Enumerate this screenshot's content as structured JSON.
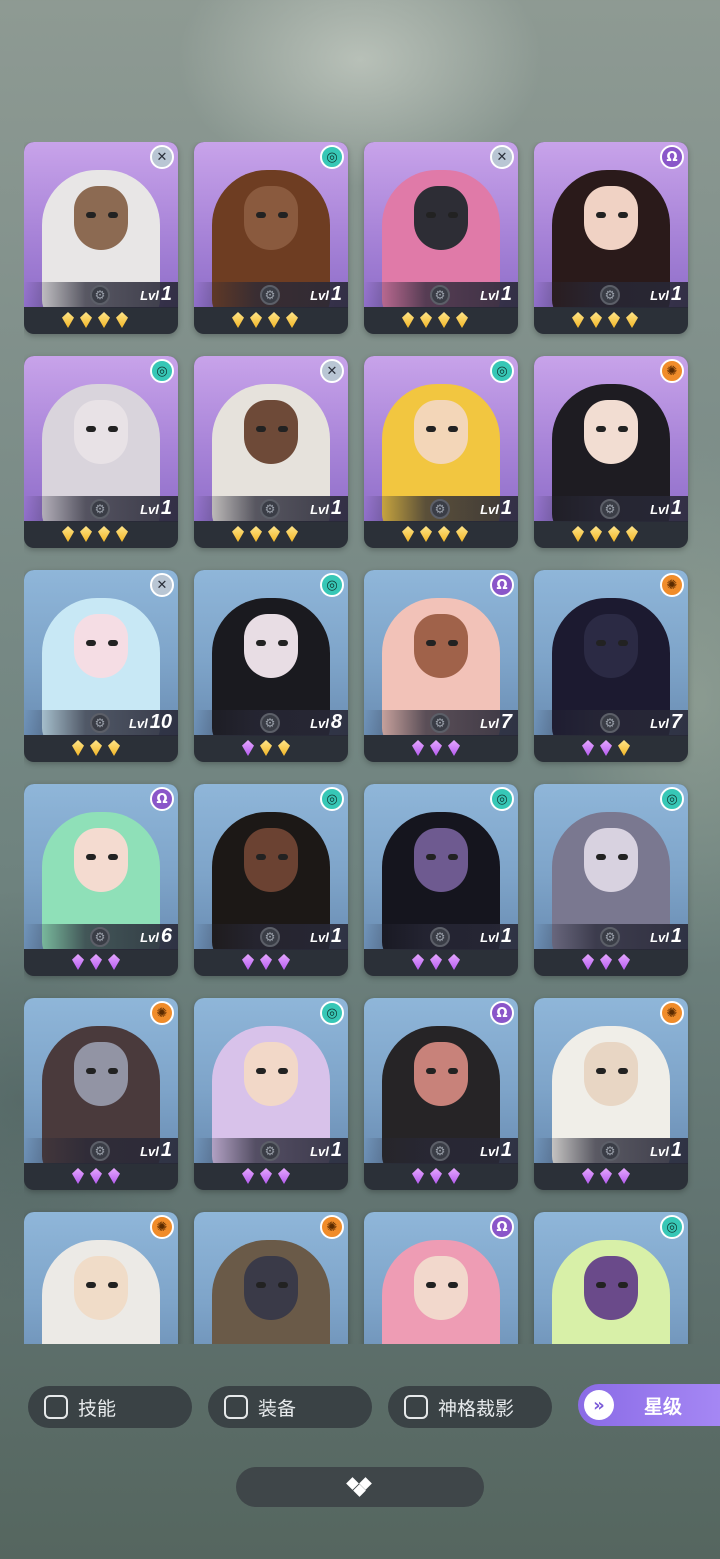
{
  "cards": [
    {
      "bg": "purple",
      "class_icon": "close-x",
      "class_symbol": "✕",
      "level": "1",
      "gems": "gold",
      "gem_count": 4,
      "hair": "#e8e6e6",
      "skin": "#8c6a52"
    },
    {
      "bg": "purple",
      "class_icon": "spiral",
      "class_symbol": "◎",
      "level": "1",
      "gems": "gold",
      "gem_count": 4,
      "hair": "#6e3d22",
      "skin": "#8a5a3e"
    },
    {
      "bg": "purple",
      "class_icon": "close-x",
      "class_symbol": "✕",
      "level": "1",
      "gems": "gold",
      "gem_count": 4,
      "hair": "#e07aa8",
      "skin": "#2d2d35"
    },
    {
      "bg": "purple",
      "class_icon": "omega",
      "class_symbol": "Ω",
      "level": "1",
      "gems": "gold",
      "gem_count": 4,
      "hair": "#2a1a1a",
      "skin": "#f0d2c4"
    },
    {
      "bg": "purple",
      "class_icon": "spiral",
      "class_symbol": "◎",
      "level": "1",
      "gems": "gold",
      "gem_count": 4,
      "hair": "#d9d4dc",
      "skin": "#e8e2e6"
    },
    {
      "bg": "purple",
      "class_icon": "close-x",
      "class_symbol": "✕",
      "level": "1",
      "gems": "gold",
      "gem_count": 4,
      "hair": "#e6e2dc",
      "skin": "#6e4a38"
    },
    {
      "bg": "purple",
      "class_icon": "spiral",
      "class_symbol": "◎",
      "level": "1",
      "gems": "gold",
      "gem_count": 4,
      "hair": "#f2c640",
      "skin": "#f3d6b8"
    },
    {
      "bg": "purple",
      "class_icon": "sun",
      "class_symbol": "✺",
      "level": "1",
      "gems": "gold",
      "gem_count": 4,
      "hair": "#1e1c22",
      "skin": "#f2ddd2"
    },
    {
      "bg": "blue",
      "class_icon": "close-x",
      "class_symbol": "✕",
      "level": "10",
      "gems": "gold",
      "gem_count": 3,
      "hair": "#c8e8f5",
      "skin": "#f5dde4"
    },
    {
      "bg": "blue",
      "class_icon": "spiral",
      "class_symbol": "◎",
      "level": "8",
      "gems": "mixed",
      "gem_count": 3,
      "hair": "#1a1a1f",
      "skin": "#e8dde4"
    },
    {
      "bg": "blue",
      "class_icon": "omega",
      "class_symbol": "Ω",
      "level": "7",
      "gems": "purple",
      "gem_count": 3,
      "hair": "#f2c2b8",
      "skin": "#a0624a"
    },
    {
      "bg": "blue",
      "class_icon": "sun",
      "class_symbol": "✺",
      "level": "7",
      "gems": "mixed2",
      "gem_count": 3,
      "hair": "#1c1a30",
      "skin": "#2b2a44"
    },
    {
      "bg": "blue",
      "class_icon": "omega",
      "class_symbol": "Ω",
      "level": "6",
      "gems": "purple",
      "gem_count": 3,
      "hair": "#8fe0b8",
      "skin": "#f4dbd0"
    },
    {
      "bg": "blue",
      "class_icon": "spiral",
      "class_symbol": "◎",
      "level": "1",
      "gems": "purple",
      "gem_count": 3,
      "hair": "#1c1816",
      "skin": "#6b4232"
    },
    {
      "bg": "blue",
      "class_icon": "spiral",
      "class_symbol": "◎",
      "level": "1",
      "gems": "purple",
      "gem_count": 3,
      "hair": "#15151e",
      "skin": "#6e5a90"
    },
    {
      "bg": "blue",
      "class_icon": "spiral",
      "class_symbol": "◎",
      "level": "1",
      "gems": "purple",
      "gem_count": 3,
      "hair": "#7a7890",
      "skin": "#d8d2e0"
    },
    {
      "bg": "blue",
      "class_icon": "sun",
      "class_symbol": "✺",
      "level": "1",
      "gems": "purple",
      "gem_count": 3,
      "hair": "#4a3a3c",
      "skin": "#9294a4"
    },
    {
      "bg": "blue",
      "class_icon": "spiral",
      "class_symbol": "◎",
      "level": "1",
      "gems": "purple",
      "gem_count": 3,
      "hair": "#d8c2ea",
      "skin": "#f2d8c8"
    },
    {
      "bg": "blue",
      "class_icon": "omega",
      "class_symbol": "Ω",
      "level": "1",
      "gems": "purple",
      "gem_count": 3,
      "hair": "#262426",
      "skin": "#c8827a"
    },
    {
      "bg": "blue",
      "class_icon": "sun",
      "class_symbol": "✺",
      "level": "1",
      "gems": "purple",
      "gem_count": 3,
      "hair": "#f0eee8",
      "skin": "#e8d6c4"
    },
    {
      "bg": "blue",
      "class_icon": "sun",
      "class_symbol": "✺",
      "level": "",
      "gems": "none",
      "gem_count": 0,
      "hair": "#eceae6",
      "skin": "#f0dcc8"
    },
    {
      "bg": "blue",
      "class_icon": "sun",
      "class_symbol": "✺",
      "level": "",
      "gems": "none",
      "gem_count": 0,
      "hair": "#6a5a48",
      "skin": "#3a3a48"
    },
    {
      "bg": "blue",
      "class_icon": "omega",
      "class_symbol": "Ω",
      "level": "",
      "gems": "none",
      "gem_count": 0,
      "hair": "#ee9cb4",
      "skin": "#f2d8cc"
    },
    {
      "bg": "blue",
      "class_icon": "spiral",
      "class_symbol": "◎",
      "level": "",
      "gems": "none",
      "gem_count": 0,
      "hair": "#d8f0a8",
      "skin": "#6a4a8a"
    }
  ],
  "level_prefix": "Lvl",
  "filters": {
    "skill": "技能",
    "equipment": "装备",
    "divine_projection": "神格裁影",
    "star_level": "星级"
  },
  "icons": {
    "filter_toggle": "chevron-down-double-icon",
    "bottom_bar": "diamond-cluster-icon"
  }
}
